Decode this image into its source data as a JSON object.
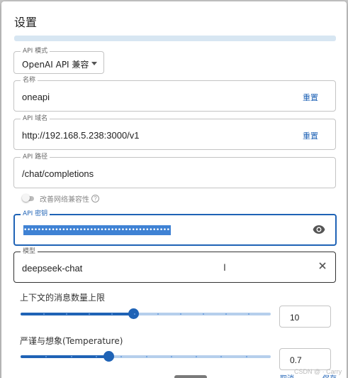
{
  "dialog": {
    "title": "设置"
  },
  "api_mode": {
    "legend": "API 模式",
    "value": "OpenAI API 兼容"
  },
  "name": {
    "legend": "名称",
    "value": "oneapi",
    "reset_label": "重置"
  },
  "api_domain": {
    "legend": "API 域名",
    "value": "http://192.168.5.238:3000/v1",
    "reset_label": "重置"
  },
  "api_path": {
    "legend": "API 路径",
    "value": "/chat/completions"
  },
  "network_compat": {
    "label": "改善网络兼容性",
    "enabled": false,
    "help_icon": "?"
  },
  "api_key": {
    "legend": "API 密钥",
    "value": "••••••••••••••••••••••••••••••••••••••••••••••••••••"
  },
  "model": {
    "legend": "模型",
    "value": "deepseek-chat",
    "cursor_glyph": "Ι"
  },
  "context_limit": {
    "label": "上下文的消息数量上限",
    "value": "10",
    "slider_fraction": 0.45
  },
  "temperature": {
    "label": "严谨与想象(Temperature)",
    "value": "0.7",
    "slider_fraction": 0.35
  },
  "footer": {
    "cancel_label": "取消",
    "save_label": "保存",
    "watermark": "CSDN @ · Carry"
  },
  "colors": {
    "accent": "#1f63b6",
    "track_light": "#b6cfec",
    "border": "#c4c4c4"
  }
}
